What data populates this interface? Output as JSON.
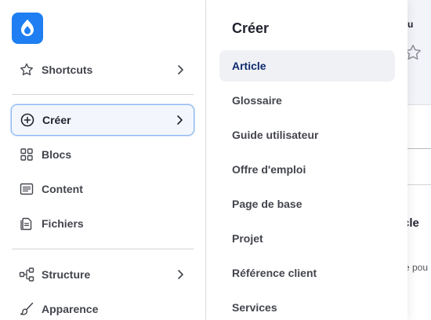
{
  "background": {
    "title_fragment": "u",
    "heading_fragment": "cle",
    "text_fragment": "e pou"
  },
  "sidebar": {
    "logo": "drupal-drop-logo",
    "items": [
      {
        "label": "Shortcuts",
        "icon": "star-icon",
        "has_children": true
      },
      {
        "label": "Créer",
        "icon": "plus-circle-icon",
        "has_children": true,
        "active": true
      },
      {
        "label": "Blocs",
        "icon": "blocks-grid-icon",
        "has_children": false
      },
      {
        "label": "Content",
        "icon": "content-list-icon",
        "has_children": false
      },
      {
        "label": "Fichiers",
        "icon": "files-icon",
        "has_children": false
      },
      {
        "label": "Structure",
        "icon": "structure-icon",
        "has_children": true
      },
      {
        "label": "Apparence",
        "icon": "brush-icon",
        "has_children": false
      }
    ]
  },
  "submenu": {
    "title": "Créer",
    "items": [
      {
        "label": "Article",
        "selected": true
      },
      {
        "label": "Glossaire"
      },
      {
        "label": "Guide utilisateur"
      },
      {
        "label": "Offre d'emploi"
      },
      {
        "label": "Page de base"
      },
      {
        "label": "Projet"
      },
      {
        "label": "Référence client"
      },
      {
        "label": "Services"
      }
    ]
  },
  "colors": {
    "accent": "#1e7ef2",
    "active_border": "#8eb8f1",
    "selected_bg": "#f0f1f5",
    "selected_text": "#0d2c6e"
  }
}
